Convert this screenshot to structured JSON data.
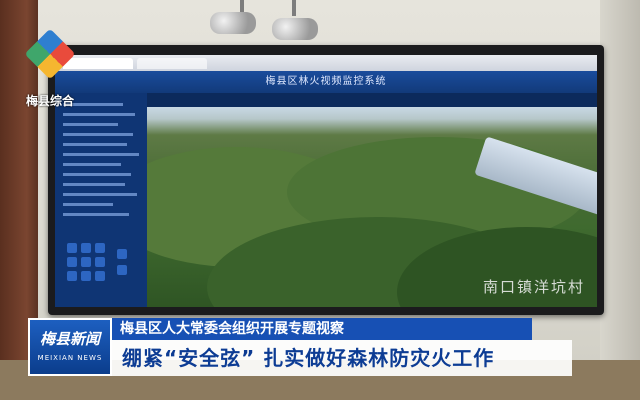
{
  "broadcast": {
    "station_logo_text": "梅县综合",
    "news_badge_cn": "梅县新闻",
    "news_badge_en": "MEIXIAN NEWS",
    "headline_top": "梅县区人大常委会组织开展专题视察",
    "headline_main": "绷紧“安全弦” 扎实做好森林防灾火工作"
  },
  "screen": {
    "app_title": "梅县区林火视频监控系统",
    "video_overlay_text": "南口镇洋坑村"
  },
  "colors": {
    "banner_blue": "#1750b4",
    "headline_text": "#0d3c94"
  }
}
